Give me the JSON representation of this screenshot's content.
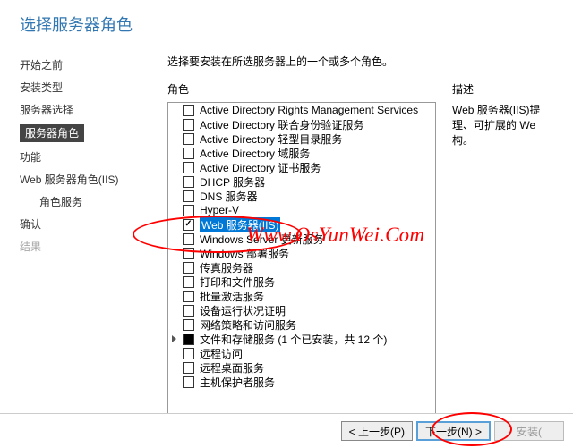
{
  "title": "选择服务器角色",
  "instruction": "选择要安装在所选服务器上的一个或多个角色。",
  "sidebar": {
    "items": [
      {
        "label": "开始之前"
      },
      {
        "label": "安装类型"
      },
      {
        "label": "服务器选择"
      },
      {
        "label": "服务器角色",
        "active": true
      },
      {
        "label": "功能"
      },
      {
        "label": "Web 服务器角色(IIS)"
      },
      {
        "label": "角色服务",
        "sub": true
      },
      {
        "label": "确认"
      },
      {
        "label": "结果",
        "dim": true
      }
    ]
  },
  "roles": {
    "header": "角色",
    "items": [
      {
        "label": "Active Directory Rights Management Services"
      },
      {
        "label": "Active Directory 联合身份验证服务"
      },
      {
        "label": "Active Directory 轻型目录服务"
      },
      {
        "label": "Active Directory 域服务"
      },
      {
        "label": "Active Directory 证书服务"
      },
      {
        "label": "DHCP 服务器"
      },
      {
        "label": "DNS 服务器"
      },
      {
        "label": "Hyper-V"
      },
      {
        "label": "Web 服务器(IIS)",
        "checked": true,
        "selected": true
      },
      {
        "label": "Windows Server 更新服务"
      },
      {
        "label": "Windows 部署服务"
      },
      {
        "label": "传真服务器"
      },
      {
        "label": "打印和文件服务"
      },
      {
        "label": "批量激活服务"
      },
      {
        "label": "设备运行状况证明"
      },
      {
        "label": "网络策略和访问服务"
      },
      {
        "label": "文件和存储服务 (1 个已安装，共 12 个)",
        "filled": true,
        "expandable": true
      },
      {
        "label": "远程访问"
      },
      {
        "label": "远程桌面服务"
      },
      {
        "label": "主机保护者服务"
      }
    ]
  },
  "description": {
    "header": "描述",
    "line1": "Web 服务器(IIS)提",
    "line2": "理、可扩展的 We",
    "line3": "构。"
  },
  "footer": {
    "prev": "< 上一步(P)",
    "next": "下一步(N) >",
    "install": "安装(",
    "cancel": ""
  },
  "watermark": "Www.OsYunWei.Com"
}
